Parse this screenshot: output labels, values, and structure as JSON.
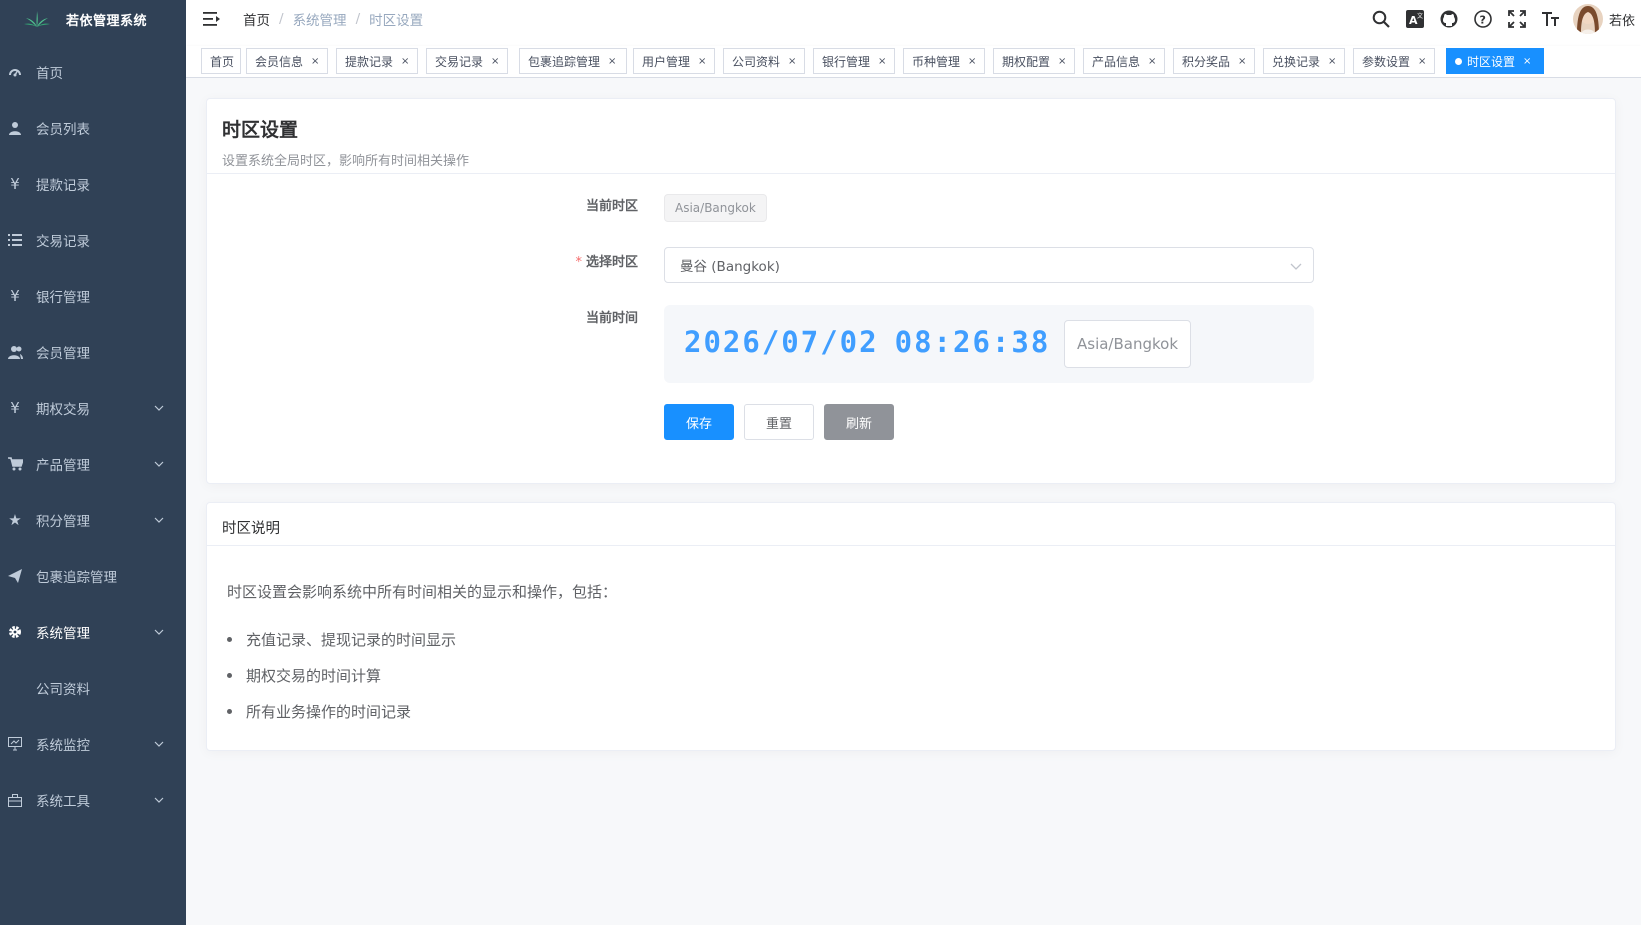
{
  "app": {
    "title": "若依管理系统"
  },
  "sidebar": {
    "items": [
      {
        "label": "首页",
        "icon": "dashboard-icon"
      },
      {
        "label": "会员列表",
        "icon": "user-icon"
      },
      {
        "label": "提款记录",
        "icon": "yen-icon"
      },
      {
        "label": "交易记录",
        "icon": "list-icon"
      },
      {
        "label": "银行管理",
        "icon": "yen-icon"
      },
      {
        "label": "会员管理",
        "icon": "peoples-icon"
      },
      {
        "label": "期权交易",
        "icon": "yen-icon",
        "expandable": true
      },
      {
        "label": "产品管理",
        "icon": "cart-icon",
        "expandable": true
      },
      {
        "label": "积分管理",
        "icon": "star-icon",
        "expandable": true
      },
      {
        "label": "包裹追踪管理",
        "icon": "send-icon"
      },
      {
        "label": "系统管理",
        "icon": "gear-icon",
        "expandable": true,
        "active": true
      },
      {
        "label": "公司资料",
        "icon": "",
        "sub": true
      },
      {
        "label": "系统监控",
        "icon": "monitor-icon",
        "expandable": true
      },
      {
        "label": "系统工具",
        "icon": "toolbox-icon",
        "expandable": true
      }
    ]
  },
  "navbar": {
    "breadcrumb": [
      "首页",
      "系统管理",
      "时区设置"
    ],
    "user_name": "若依"
  },
  "tags": [
    {
      "label": "首页",
      "closable": false
    },
    {
      "label": "会员信息",
      "closable": true
    },
    {
      "label": "提款记录",
      "closable": true
    },
    {
      "label": "交易记录",
      "closable": true
    },
    {
      "label": "包裹追踪管理",
      "closable": true
    },
    {
      "label": "用户管理",
      "closable": true
    },
    {
      "label": "公司资料",
      "closable": true
    },
    {
      "label": "银行管理",
      "closable": true
    },
    {
      "label": "币种管理",
      "closable": true
    },
    {
      "label": "期权配置",
      "closable": true
    },
    {
      "label": "产品信息",
      "closable": true
    },
    {
      "label": "积分奖品",
      "closable": true
    },
    {
      "label": "兑换记录",
      "closable": true
    },
    {
      "label": "参数设置",
      "closable": true
    },
    {
      "label": "时区设置",
      "closable": true,
      "active": true
    }
  ],
  "page": {
    "title": "时区设置",
    "subtitle": "设置系统全局时区，影响所有时间相关操作",
    "current_zone_label": "当前时区",
    "current_zone_value": "Asia/Bangkok",
    "select_label": "选择时区",
    "select_value": "曼谷 (Bangkok)",
    "current_time_label": "当前时间",
    "clock_date": "2026/07/02",
    "clock_time": "08:26:38",
    "clock_zone": "Asia/Bangkok",
    "buttons": {
      "save": "保存",
      "reset": "重置",
      "refresh": "刷新"
    }
  },
  "description": {
    "title": "时区说明",
    "intro": "时区设置会影响系统中所有时间相关的显示和操作，包括：",
    "items": [
      "充值记录、提现记录的时间显示",
      "期权交易的时间计算",
      "所有业务操作的时间记录"
    ]
  },
  "colors": {
    "sidebar_bg": "#304156",
    "primary": "#1890ff",
    "clock": "#409eff",
    "required": "#f56c6c"
  }
}
